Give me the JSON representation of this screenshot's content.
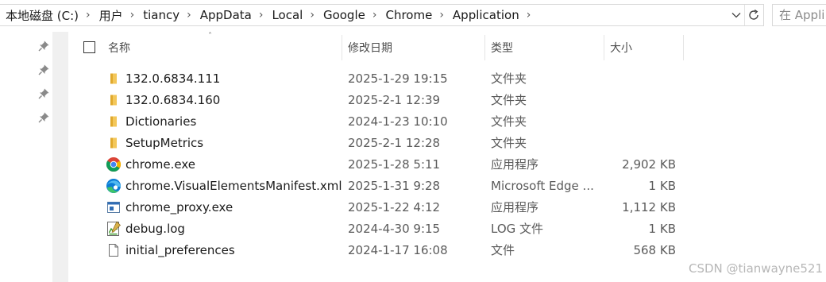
{
  "breadcrumb": [
    "本地磁盘 (C:)",
    "用户",
    "tiancy",
    "AppData",
    "Local",
    "Google",
    "Chrome",
    "Application"
  ],
  "search": {
    "placeholder": "在 Appli"
  },
  "columns": {
    "name": "名称",
    "date": "修改日期",
    "type": "类型",
    "size": "大小"
  },
  "files": [
    {
      "name": "132.0.6834.111",
      "date": "2025-1-29 19:15",
      "type": "文件夹",
      "size": "",
      "icon": "folder-icon"
    },
    {
      "name": "132.0.6834.160",
      "date": "2025-2-1 12:39",
      "type": "文件夹",
      "size": "",
      "icon": "folder-icon"
    },
    {
      "name": "Dictionaries",
      "date": "2024-1-23 10:10",
      "type": "文件夹",
      "size": "",
      "icon": "folder-icon"
    },
    {
      "name": "SetupMetrics",
      "date": "2025-2-1 12:28",
      "type": "文件夹",
      "size": "",
      "icon": "folder-icon"
    },
    {
      "name": "chrome.exe",
      "date": "2025-1-28 5:11",
      "type": "应用程序",
      "size": "2,902 KB",
      "icon": "chrome-icon"
    },
    {
      "name": "chrome.VisualElementsManifest.xml",
      "date": "2025-1-31 9:28",
      "type": "Microsoft Edge ...",
      "size": "1 KB",
      "icon": "edge-icon"
    },
    {
      "name": "chrome_proxy.exe",
      "date": "2025-1-22 4:12",
      "type": "应用程序",
      "size": "1,112 KB",
      "icon": "app-window-icon"
    },
    {
      "name": "debug.log",
      "date": "2024-4-30 9:15",
      "type": "LOG 文件",
      "size": "1 KB",
      "icon": "log-file-icon"
    },
    {
      "name": "initial_preferences",
      "date": "2024-1-17 16:08",
      "type": "文件",
      "size": "568 KB",
      "icon": "blank-file-icon"
    }
  ],
  "watermark": "CSDN @tianwayne521",
  "colors": {
    "folder": "#f3c75a",
    "chrome_red": "#db4437",
    "chrome_green": "#0f9d58",
    "chrome_yellow": "#f4b400",
    "chrome_blue": "#4285f4",
    "edge_blue": "#0c7cd5",
    "edge_green": "#3fc468"
  }
}
